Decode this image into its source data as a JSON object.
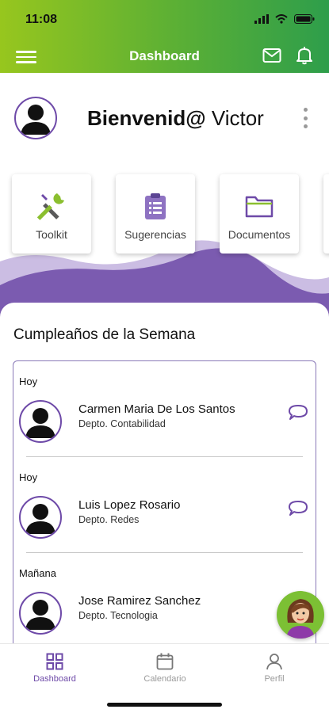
{
  "status_bar": {
    "time": "11:08"
  },
  "header": {
    "title": "Dashboard"
  },
  "welcome": {
    "greeting": "Bienvenid@",
    "user_name": "Victor"
  },
  "quick_actions": [
    {
      "label": "Toolkit",
      "icon": "toolkit-icon"
    },
    {
      "label": "Sugerencias",
      "icon": "clipboard-icon"
    },
    {
      "label": "Documentos",
      "icon": "folder-icon"
    }
  ],
  "birthdays": {
    "title": "Cumpleaños de la Semana",
    "items": [
      {
        "when": "Hoy",
        "name": "Carmen Maria De Los Santos",
        "dept": "Depto. Contabilidad",
        "has_chat": true
      },
      {
        "when": "Hoy",
        "name": "Luis Lopez Rosario",
        "dept": "Depto. Redes",
        "has_chat": true
      },
      {
        "when": "Mañana",
        "name": "Jose Ramirez Sanchez",
        "dept": "Depto. Tecnologia",
        "has_chat": false
      }
    ]
  },
  "tabs": [
    {
      "label": "Dashboard",
      "icon": "dashboard-icon",
      "active": true
    },
    {
      "label": "Calendario",
      "icon": "calendar-icon",
      "active": false
    },
    {
      "label": "Perfil",
      "icon": "profile-icon",
      "active": false
    }
  ],
  "colors": {
    "brand_purple": "#6e4aa8",
    "header_green_start": "#97c61e",
    "header_green_end": "#2e9e4b",
    "wave_purple": "#7b5bb0"
  }
}
